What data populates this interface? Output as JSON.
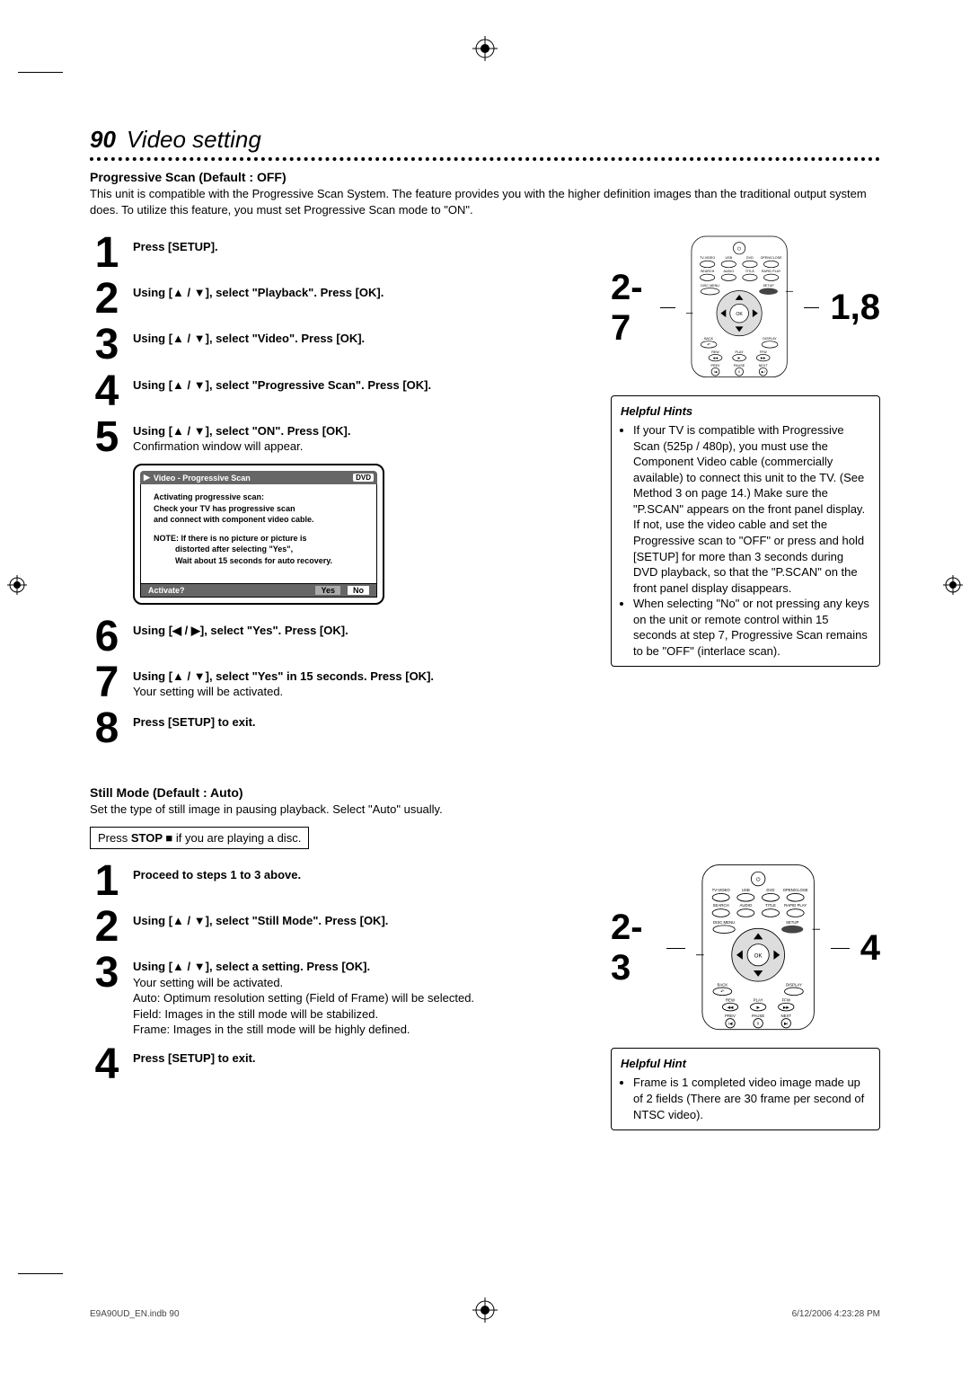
{
  "header": {
    "page_number": "90",
    "title": "Video setting"
  },
  "section1": {
    "heading": "Progressive Scan (Default : OFF)",
    "intro": "This unit is compatible with the Progressive Scan System. The feature provides you with the higher definition images than the traditional output system does. To utilize this feature, you must set Progressive Scan mode to \"ON\".",
    "steps": [
      {
        "n": "1",
        "bold": "Press [SETUP].",
        "plain": ""
      },
      {
        "n": "2",
        "bold": "Using [▲ / ▼], select \"Playback\". Press [OK].",
        "plain": ""
      },
      {
        "n": "3",
        "bold": "Using [▲ / ▼], select \"Video\". Press [OK].",
        "plain": ""
      },
      {
        "n": "4",
        "bold": "Using [▲ / ▼], select \"Progressive Scan\". Press [OK].",
        "plain": ""
      },
      {
        "n": "5",
        "bold": "Using [▲ / ▼], select \"ON\". Press [OK].",
        "plain": "Confirmation window will appear."
      },
      {
        "n": "6",
        "bold": "Using [◀ / ▶], select \"Yes\". Press [OK].",
        "plain": ""
      },
      {
        "n": "7",
        "bold": "Using [▲ / ▼], select \"Yes\" in 15 seconds. Press [OK].",
        "plain": "Your setting will be activated."
      },
      {
        "n": "8",
        "bold": "Press [SETUP] to exit.",
        "plain": ""
      }
    ],
    "osd": {
      "icon": "▶",
      "title": "Video - Progressive Scan",
      "badge": "DVD",
      "line1": "Activating progressive scan:",
      "line2": "Check your TV has progressive scan",
      "line3": "and connect with component video cable.",
      "note_label": "NOTE:",
      "note1": "If there is no picture or picture is",
      "note2": "distorted after selecting \"Yes\",",
      "note3": "Wait about 15 seconds for auto recovery.",
      "footer_q": "Activate?",
      "footer_yes": "Yes",
      "footer_no": "No"
    },
    "remote_callout_left": "2-7",
    "remote_callout_right": "1,8",
    "hints_title": "Helpful Hints",
    "hints": [
      "If your TV is compatible with Progressive Scan (525p / 480p), you must use the Component Video cable (commercially available) to connect this unit to the TV. (See Method 3 on page 14.) Make sure the \"P.SCAN\" appears on the front panel display.\nIf not, use the video cable and set the Progressive scan to \"OFF\" or press and hold [SETUP] for more than 3 seconds during DVD playback, so that the \"P.SCAN\" on the front panel display disappears.",
      "When selecting \"No\" or not pressing any keys on the unit or remote control within 15 seconds at step 7, Progressive Scan remains to be \"OFF\" (interlace scan)."
    ]
  },
  "section2": {
    "heading": "Still Mode (Default : Auto)",
    "intro": "Set the type of still image in pausing playback. Select \"Auto\" usually.",
    "note_bar_pre": "Press ",
    "note_bar_bold": "STOP ■",
    "note_bar_post": " if you are playing a disc.",
    "steps": [
      {
        "n": "1",
        "bold": "Proceed to steps 1 to 3 above.",
        "plain": ""
      },
      {
        "n": "2",
        "bold": "Using [▲ / ▼], select \"Still Mode\". Press [OK].",
        "plain": ""
      },
      {
        "n": "3",
        "bold": "Using [▲ / ▼], select a setting. Press [OK].",
        "plain": "Your setting will be activated.\nAuto:  Optimum resolution setting (Field of Frame) will be selected.\nField:  Images in the still mode will be stabilized.\nFrame: Images in the still mode will be highly defined."
      },
      {
        "n": "4",
        "bold": "Press [SETUP] to exit.",
        "plain": ""
      }
    ],
    "remote_callout_left": "2-3",
    "remote_callout_right": "4",
    "hint_title": "Helpful Hint",
    "hint": "Frame is 1 completed video image made up of 2 fields (There are 30 frame per second of NTSC video)."
  },
  "remote_labels": {
    "tv_video": "TV-VIDEO",
    "usb": "USB",
    "dvd": "DVD",
    "open": "OPEN/CLOSE",
    "search": "SEARCH",
    "audio": "AUDIO",
    "title": "TITLE",
    "rapid": "RAPID PLAY",
    "disc_menu": "DISC MENU",
    "setup": "SETUP",
    "ok": "OK",
    "back": "BACK",
    "display": "DISPLAY",
    "rew": "REW",
    "play": "PLAY",
    "ffw": "FFW",
    "prev": "PREV",
    "pause": "PAUSE",
    "next": "NEXT"
  },
  "footer": {
    "left": "E9A90UD_EN.indb   90",
    "right": "6/12/2006   4:23:28 PM"
  }
}
